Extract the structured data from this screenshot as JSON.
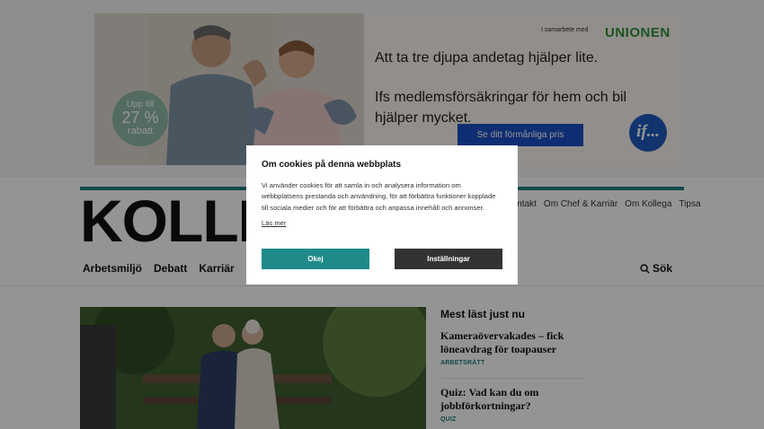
{
  "ad": {
    "partner_text": "I samarbete med",
    "brand": "UNIONEN",
    "badge": {
      "line1": "Upp till",
      "line2": "27 %",
      "line3": "rabatt"
    },
    "headline": "Att ta tre djupa andetag hjälper lite.",
    "subline": "Ifs medlemsförsäkringar för hem och bil hjälper mycket.",
    "cta": "Se ditt förmånliga pris",
    "logo": "if..."
  },
  "site": {
    "logo": "KOLLEGA",
    "topnav": [
      "Kontakt",
      "Om Chef & Karriär",
      "Om Kollega",
      "Tipsa"
    ],
    "mainnav": [
      "Arbetsmiljö",
      "Debatt",
      "Karriär"
    ],
    "search_label": "Sök"
  },
  "most_read": {
    "title": "Mest läst just nu",
    "articles": [
      {
        "title": "Kameraövervakades – fick löneavdrag för toapauser",
        "category": "ARBETSRÄTT"
      },
      {
        "title": "Quiz: Vad kan du om jobbförkortningar?",
        "category": "QUIZ"
      }
    ]
  },
  "cookie_dialog": {
    "title": "Om cookies på denna webbplats",
    "body": "Vi använder cookies för att samla in och analysera information om webbplatsens prestanda och användning, för att förbättra funktioner kopplade till sociala medier och för att förbättra och anpassa innehåll och annonser.",
    "read_more": "Läs mer",
    "ok_label": "Okej",
    "settings_label": "Inställningar"
  },
  "colors": {
    "accent": "#1f8a8a",
    "ad_cta": "#1a4fc4",
    "overlay": "rgba(0,0,0,0.42)"
  }
}
